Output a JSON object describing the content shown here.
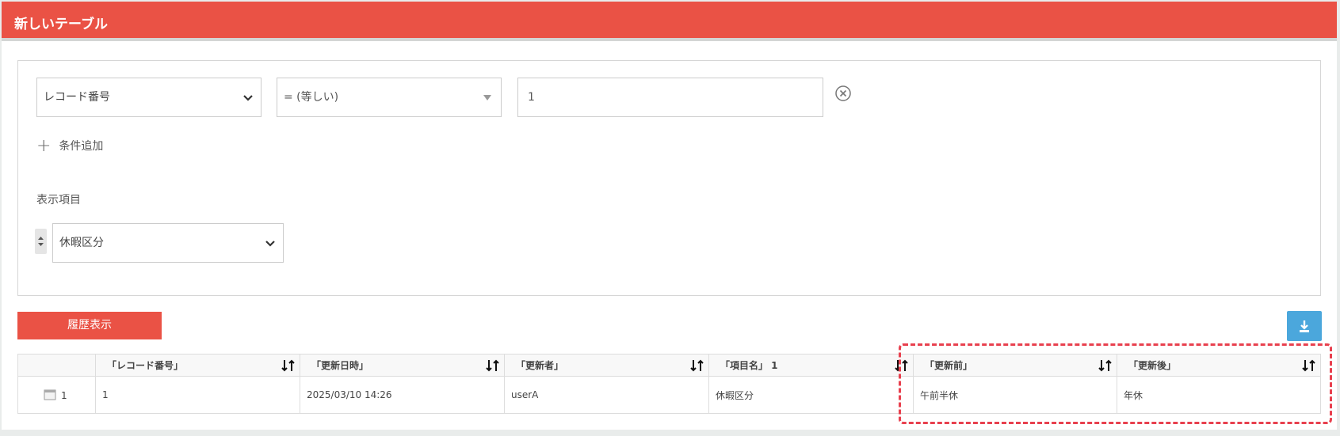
{
  "window": {
    "title": "新しいテーブル"
  },
  "filter": {
    "field_value": "レコード番号",
    "operator_value": "= (等しい)",
    "input_value": "1",
    "add_condition_label": "条件追加"
  },
  "display": {
    "label": "表示項目",
    "field_value": "休暇区分"
  },
  "actions": {
    "history_label": "履歴表示",
    "download_icon": "download-icon"
  },
  "table": {
    "columns": [
      "",
      "「レコード番号」",
      "「更新日時」",
      "「更新者」",
      "「項目名」 1",
      "「更新前」",
      "「更新後」"
    ],
    "rows": [
      {
        "index": "1",
        "cells": [
          "1",
          "2025/03/10 14:26",
          "userA",
          "休暇区分",
          "午前半休",
          "年休"
        ]
      }
    ]
  },
  "colors": {
    "header": "#ea5245",
    "history_button": "#ea5245",
    "download_button": "#4ba7dc",
    "highlight": "#e8404e"
  }
}
